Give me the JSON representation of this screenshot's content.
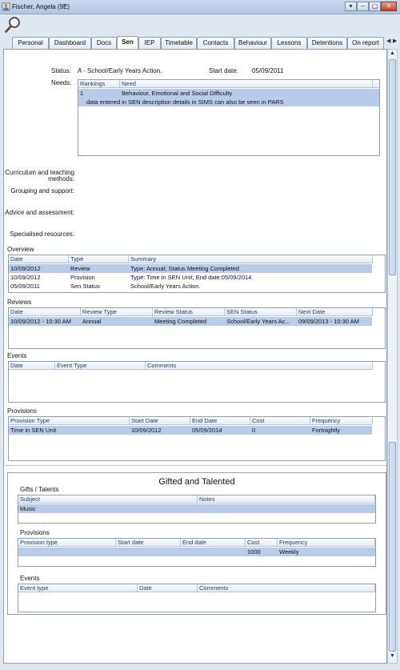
{
  "window": {
    "title": "Fischer, Angela (9E)",
    "pin_glyph": "ᵠ",
    "buttons": [
      "▾",
      "–",
      "▢",
      "✕"
    ]
  },
  "tabs": {
    "items": [
      "Personal",
      "Dashboard",
      "Docs",
      "Sen",
      "IEP",
      "Timetable",
      "Contacts",
      "Behaviour",
      "Lessons",
      "Detentions",
      "On report"
    ],
    "active": "Sen",
    "scroll_left": "◀",
    "scroll_right": "▶"
  },
  "sen": {
    "status_label": "Status:",
    "status_value": "A - School/Early Years Action.",
    "start_date_label": "Start date:",
    "start_date_value": "05/09/2011",
    "needs_label": "Needs:",
    "needs_headers": [
      "Rankings",
      "Need"
    ],
    "needs_rows": [
      [
        "1",
        "Behaviour, Emotional and Social Difficulty"
      ],
      [
        "",
        "data entered in SEN description details in SIMS can also be seen in PARS"
      ]
    ],
    "curriculum_label_1": "Curriculum and teaching",
    "curriculum_label_2": "methods:",
    "grouping_label": "Grouping and support:",
    "advice_label": "Advice and assessment:",
    "specialised_label": "Specialised resources:"
  },
  "overview": {
    "title": "Overview",
    "headers": [
      "Date",
      "Type",
      "Summary"
    ],
    "rows": [
      [
        "10/09/2012",
        "Review",
        "Type: Annual; Status Meeting Completed"
      ],
      [
        "10/09/2012",
        "Provision",
        "Type: Time in SEN Unit; End date:05/09/2014"
      ],
      [
        "05/09/2011",
        "Sen Status",
        "School/Early Years Action."
      ]
    ]
  },
  "reviews": {
    "title": "Reviews",
    "headers": [
      "Date",
      "Review Type",
      "Review Status",
      "SEN Status",
      "Next Date"
    ],
    "rows": [
      [
        "10/09/2012 - 10:30 AM",
        "Annual",
        "Meeting Completed",
        "School/Early Years Ac...",
        "09/09/2013 - 10:30 AM"
      ]
    ]
  },
  "events": {
    "title": "Events",
    "headers": [
      "Date",
      "Event Type",
      "Comments"
    ]
  },
  "provisions": {
    "title": "Provisions",
    "headers": [
      "Provision Type",
      "Start Date",
      "End Date",
      "Cost",
      "Frequency"
    ],
    "rows": [
      [
        "Time in SEN Unit",
        "10/09/2012",
        "05/09/2014",
        "0",
        "Fortnightly"
      ]
    ]
  },
  "gifted": {
    "title": "Gifted and Talented",
    "gifts_title": "Gifts / Talents",
    "gifts_headers": [
      "Subject",
      "Notes"
    ],
    "gifts_rows": [
      [
        "Music",
        ""
      ]
    ],
    "provisions_title": "Provisions",
    "provisions_headers": [
      "Provision type",
      "Start date",
      "End date",
      "Cost",
      "Frequency"
    ],
    "provisions_rows": [
      [
        "",
        "",
        "",
        "1000",
        "Weekly"
      ]
    ],
    "events_title": "Events",
    "events_headers": [
      "Event type",
      "Date",
      "Comments"
    ]
  },
  "scrollbar": {
    "up": "▲",
    "down": "▼"
  },
  "icons": {
    "search": "magnifier-icon"
  }
}
